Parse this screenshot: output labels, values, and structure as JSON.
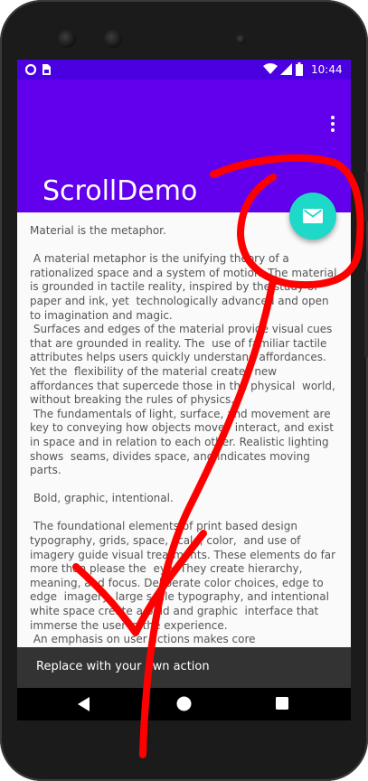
{
  "status_bar": {
    "time": "10:44",
    "icons": [
      "notification-circle-icon",
      "sim-card-icon",
      "wifi-icon",
      "cell-signal-icon",
      "battery-icon"
    ]
  },
  "app_bar": {
    "title": "ScrollDemo",
    "overflow_icon": "more-vert-icon"
  },
  "content": {
    "paragraphs": [
      "Material is the metaphor.",
      " A material metaphor is the unifying theory of a rationalized space and a system of motion. The material is grounded in tactile reality, inspired by the study of paper and ink, yet  technologically advanced and open to imagination and magic.\n Surfaces and edges of the material provide visual cues that are grounded in reality. The  use of familiar tactile attributes helps users quickly understand affordances. Yet the  flexibility of the material creates new affordances that supercede those in the physical  world, without breaking the rules of physics.\n The fundamentals of light, surface, and movement are key to conveying how objects move,  interact, and exist in space and in relation to each other. Realistic lighting shows  seams, divides space, and indicates moving parts.",
      " Bold, graphic, intentional.",
      " The foundational elements of print based design typography, grids, space, scale, color,  and use of imagery guide visual treatments. These elements do far more than please the  eye. They create hierarchy, meaning, and focus. Deliberate color choices, edge to edge  imagery, large scale typography, and intentional white space create a bold and graphic  interface that immerse the user in the experience.\n An emphasis on user actions makes core"
    ]
  },
  "fab": {
    "icon": "email-icon",
    "color": "#1fd9c8"
  },
  "snackbar": {
    "text": "Replace with your own action"
  },
  "nav_bar": {
    "icons": [
      "back-icon",
      "home-icon",
      "recents-icon"
    ]
  },
  "colors": {
    "primary": "#6200ee",
    "primary_dark": "#4a00e0",
    "accent": "#1fd9c8",
    "annotation": "#ff0000"
  }
}
